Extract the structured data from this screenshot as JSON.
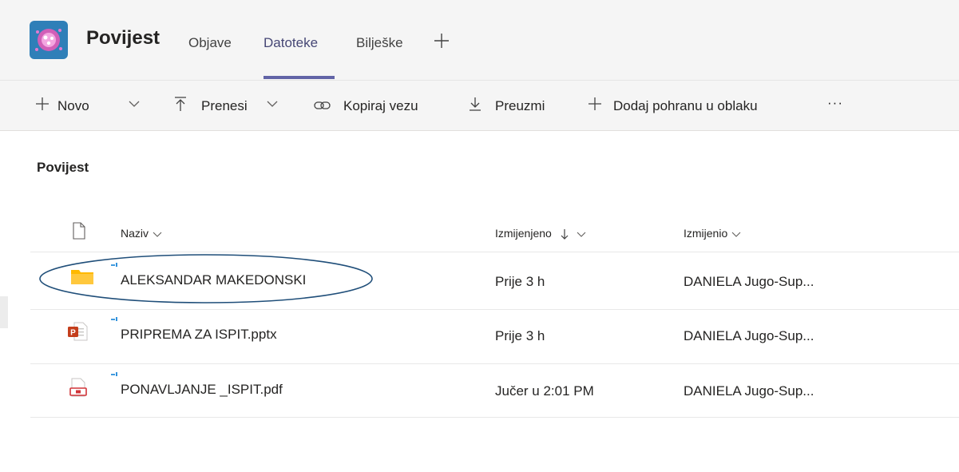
{
  "header": {
    "team_name": "Povijest",
    "tabs": [
      {
        "label": "Objave"
      },
      {
        "label": "Datoteke"
      },
      {
        "label": "Bilješke"
      }
    ],
    "active_tab": "Datoteke"
  },
  "toolbar": {
    "new_label": "Novo",
    "upload_label": "Prenesi",
    "copy_link_label": "Kopiraj vezu",
    "download_label": "Preuzmi",
    "add_storage_label": "Dodaj pohranu u oblaku",
    "more_label": "···"
  },
  "section_title": "Povijest",
  "columns": {
    "name": "Naziv",
    "modified": "Izmijenjeno",
    "modified_by": "Izmijenio"
  },
  "files": [
    {
      "name": "ALEKSANDAR MAKEDONSKI",
      "type": "folder",
      "modified": "Prije 3 h",
      "modified_by": "DANIELA Jugo-Sup...",
      "highlighted": true
    },
    {
      "name": "PRIPREMA ZA ISPIT.pptx",
      "type": "pptx",
      "modified": "Prije 3 h",
      "modified_by": "DANIELA Jugo-Sup..."
    },
    {
      "name": "PONAVLJANJE _ISPIT.pdf",
      "type": "pdf",
      "modified": "Jučer u 2:01 PM",
      "modified_by": "DANIELA Jugo-Sup..."
    }
  ],
  "colors": {
    "accent": "#6264a7",
    "folder": "#ffc83d",
    "pptx": "#c43e1c",
    "pdf": "#d13438",
    "highlight_oval": "#1f4e79",
    "sync": "#0078d4"
  }
}
